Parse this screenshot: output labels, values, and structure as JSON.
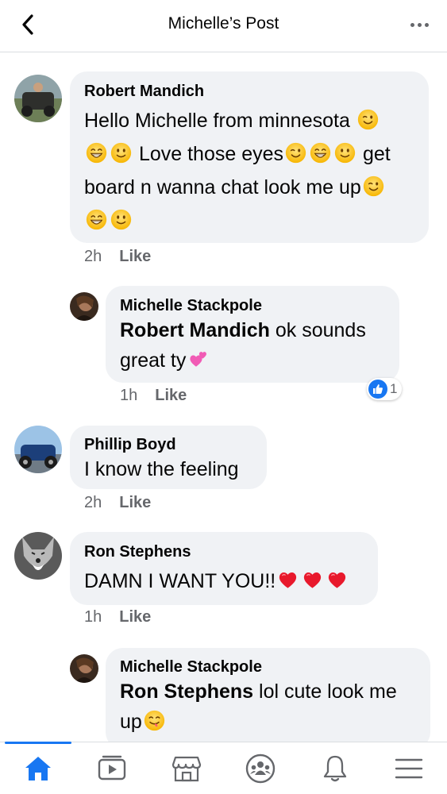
{
  "header": {
    "title": "Michelle’s Post"
  },
  "comments": [
    {
      "author": "Robert Mandich",
      "line1_text": "Hello Michelle from minnesota",
      "line2_text": " Love those eyes",
      "line2_tail": " get",
      "line3_text": "board n wanna chat look me up",
      "time": "2h",
      "like_label": "Like"
    },
    {
      "author": "Michelle Stackpole",
      "mention": "Robert Mandich",
      "text1": " ok sounds",
      "text2": "great ty",
      "time": "1h",
      "like_label": "Like",
      "reaction_count": "1"
    },
    {
      "author": "Phillip Boyd",
      "text": "I know the feeling",
      "time": "2h",
      "like_label": "Like"
    },
    {
      "author": "Ron Stephens",
      "text": "DAMN I WANT YOU!!",
      "time": "1h",
      "like_label": "Like"
    },
    {
      "author": "Michelle Stackpole",
      "mention": "Ron Stephens",
      "text1": " lol cute look me",
      "text2": "up"
    }
  ],
  "bottom_nav": [
    {
      "icon": "home-icon",
      "active": true
    },
    {
      "icon": "watch-icon",
      "active": false
    },
    {
      "icon": "marketplace-icon",
      "active": false
    },
    {
      "icon": "groups-icon",
      "active": false
    },
    {
      "icon": "notifications-icon",
      "active": false
    },
    {
      "icon": "menu-icon",
      "active": false
    }
  ],
  "colors": {
    "accent": "#1877f2",
    "bubble": "#f0f2f5",
    "secondary_text": "#65676b"
  }
}
